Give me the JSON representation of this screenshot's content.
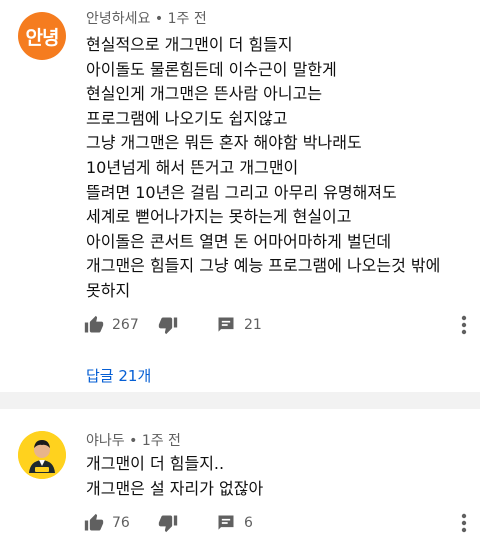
{
  "comments": [
    {
      "avatar_text": "안녕",
      "avatar_color": "#f57c1f",
      "author": "안녕하세요",
      "time": "1주 전",
      "lines": [
        "현실적으로 개그맨이 더 힘들지",
        "아이돌도 물론힘든데 이수근이 말한게",
        "현실인게 개그맨은 뜬사람 아니고는",
        "프로그램에 나오기도 쉽지않고",
        "그냥 개그맨은 뭐든 혼자 해야함 박나래도",
        "10년넘게 해서 뜬거고 개그맨이",
        "뜰려면 10년은 걸림 그리고 아무리 유명해져도",
        "세계로 뻗어나가지는 못하는게 현실이고",
        "아이돌은 콘서트 열면 돈 어마어마하게 벌던데",
        "개그맨은 힘들지 그냥 예능 프로그램에 나오는것 밖에",
        "못하지"
      ],
      "likes": "267",
      "reply_count": "21",
      "replies_label": "답글 21개"
    },
    {
      "avatar_text": "",
      "avatar_color": "#ffd21e",
      "author": "야나두",
      "time": "1주 전",
      "lines": [
        "개그맨이 더 힘들지..",
        "개그맨은 설 자리가 없잖아"
      ],
      "likes": "76",
      "reply_count": "6"
    }
  ],
  "separator": "•",
  "icons": [
    "thumb-up-icon",
    "thumb-down-icon",
    "comment-icon",
    "more-vert-icon"
  ],
  "colors": {
    "link": "#065fd4",
    "meta": "#606060",
    "icon": "#606060"
  }
}
